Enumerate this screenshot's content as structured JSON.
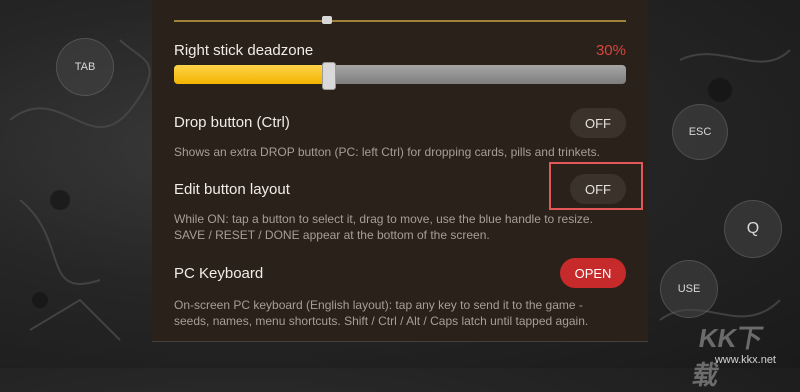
{
  "side_buttons": {
    "tab": "TAB",
    "esc": "ESC",
    "q": "Q",
    "use": "USE"
  },
  "settings": {
    "right_stick": {
      "title": "Right stick deadzone",
      "value": "30%",
      "fill_percent": 34
    },
    "drop_button": {
      "title": "Drop button (Ctrl)",
      "toggle": "OFF",
      "desc": "Shows an extra DROP button (PC: left Ctrl) for dropping cards, pills and trinkets."
    },
    "edit_layout": {
      "title": "Edit button layout",
      "toggle": "OFF",
      "desc1": "While ON: tap a button to select it, drag to move, use the blue handle to resize.",
      "desc2": "SAVE / RESET / DONE appear at the bottom of the screen."
    },
    "pc_keyboard": {
      "title": "PC Keyboard",
      "button": "OPEN",
      "desc1": "On-screen PC keyboard (English layout): tap any key to send it to the game -",
      "desc2": "seeds, names, menu shortcuts. Shift / Ctrl / Alt / Caps latch until tapped again."
    }
  },
  "watermark": {
    "url": "www.kkx.net"
  },
  "colors": {
    "accent_red": "#c62a2a",
    "slider_yellow": "#f2b400",
    "panel_bg": "#2a211b"
  }
}
